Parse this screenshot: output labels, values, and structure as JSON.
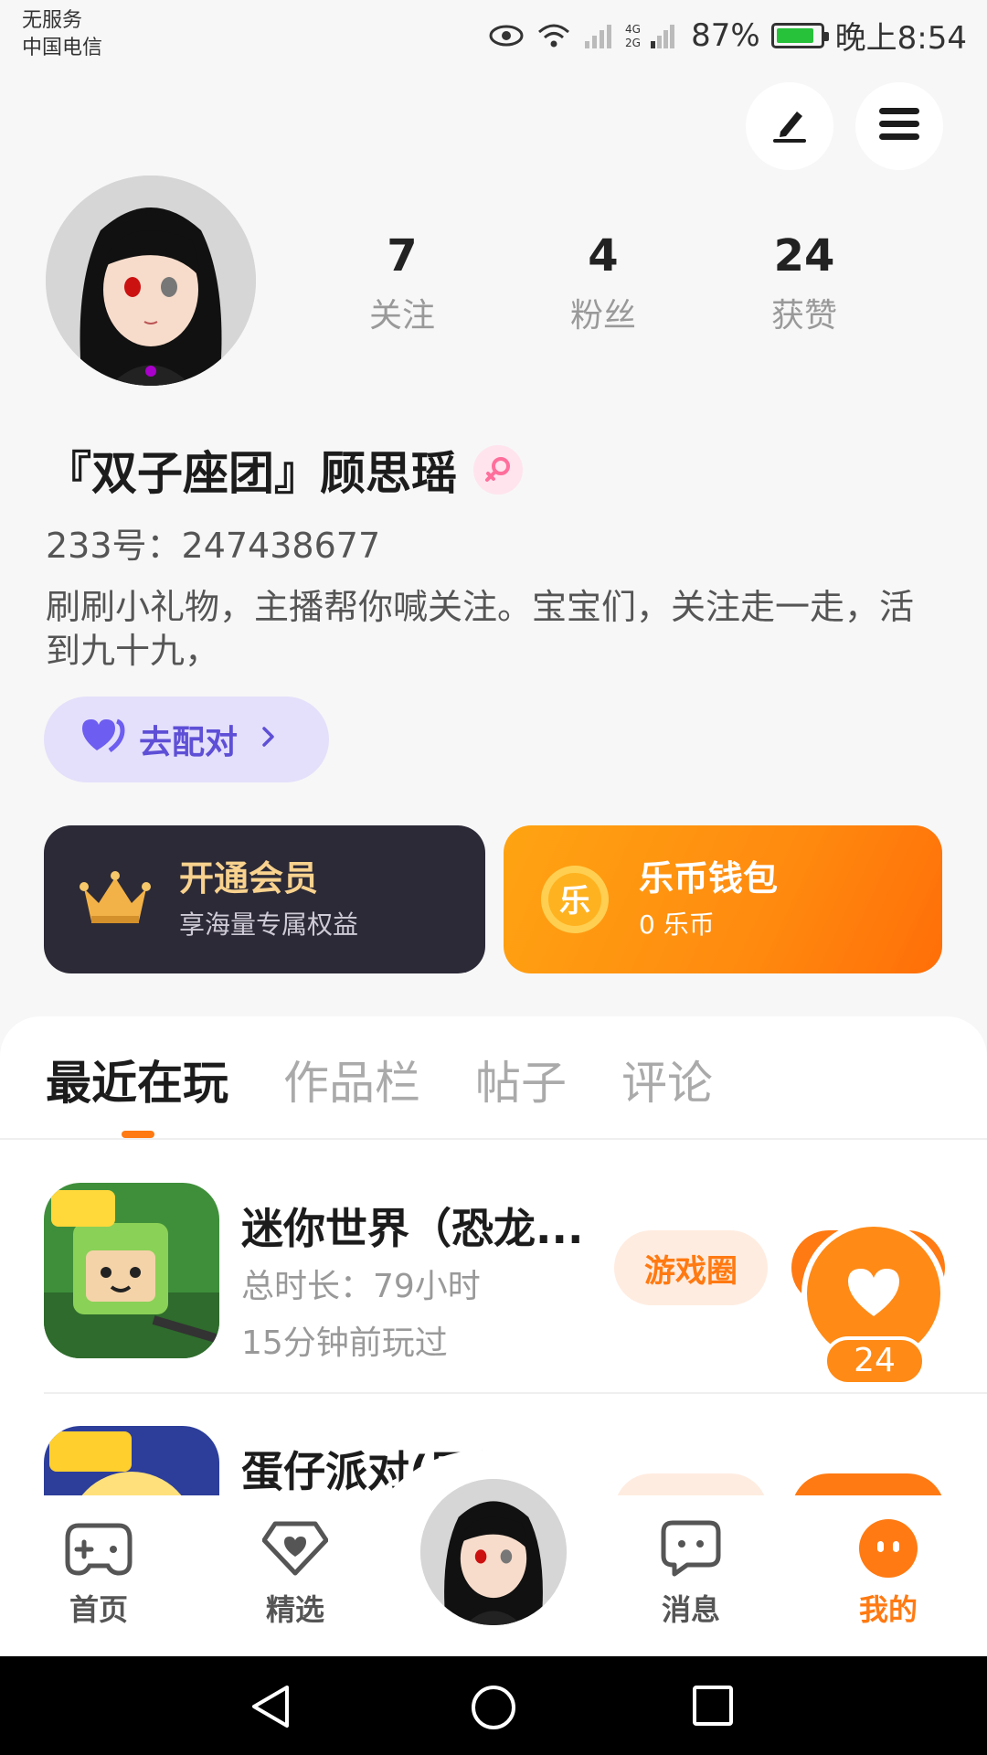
{
  "status_bar": {
    "carrier_line1": "无服务",
    "carrier_line2": "中国电信",
    "battery": "87%",
    "time": "晚上8:54",
    "battery_level": 0.87
  },
  "profile": {
    "stats": [
      {
        "value": "7",
        "label": "关注"
      },
      {
        "value": "4",
        "label": "粉丝"
      },
      {
        "value": "24",
        "label": "获赞"
      }
    ],
    "nickname": "『双子座团』顾思瑶",
    "uid": "233号：247438677",
    "bio": "刷刷小礼物，主播帮你喊关注。宝宝们，关注走一走，活到九十九，",
    "match_button": "去配对"
  },
  "cards": {
    "vip": {
      "title": "开通会员",
      "subtitle": "享海量专属权益"
    },
    "wallet": {
      "title": "乐币钱包",
      "subtitle": "0 乐币",
      "coin_glyph": "乐"
    }
  },
  "tabs": [
    "最近在玩",
    "作品栏",
    "帖子",
    "评论"
  ],
  "games": [
    {
      "title": "迷你世界（恐龙...",
      "duration": "总时长：79小时",
      "last_played": "15分钟前玩过",
      "circle_button": "游戏圈"
    },
    {
      "title": "蛋仔派对(周年..."
    }
  ],
  "like_float": {
    "count": "24"
  },
  "bottom_nav": [
    {
      "label": "首页",
      "icon": "gamepad-icon"
    },
    {
      "label": "精选",
      "icon": "heart-gem-icon"
    },
    {
      "label": "消息",
      "icon": "message-icon"
    },
    {
      "label": "我的",
      "icon": "face-icon"
    }
  ],
  "colors": {
    "accent": "#ff7a12",
    "vip_bg": "#2c2a37",
    "match_bg": "#e4e0fb",
    "match_text": "#5e4fd6"
  }
}
